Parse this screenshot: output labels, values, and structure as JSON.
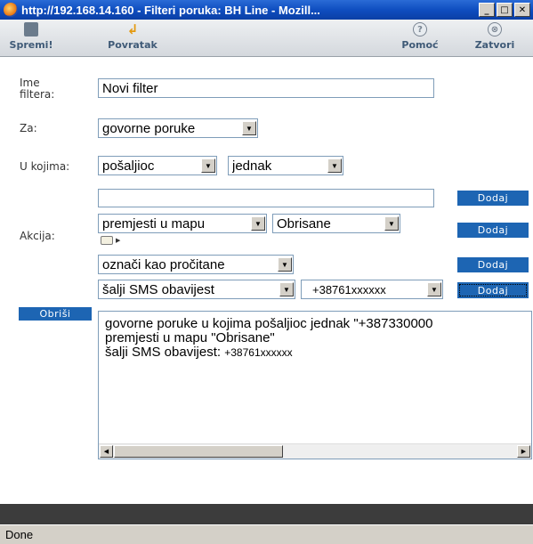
{
  "window": {
    "title": "http://192.168.14.160 - Filteri poruka: BH Line - Mozill...",
    "buttons": [
      "_",
      "□",
      "✕"
    ]
  },
  "toolbar": {
    "save_label": "Spremi!",
    "back_label": "Povratak",
    "help_label": "Pomoć",
    "close_label": "Zatvori",
    "help_glyph": "?",
    "close_glyph": "⊗",
    "back_glyph": "↲"
  },
  "form": {
    "name_label_1": "Ime",
    "name_label_2": "filtera:",
    "name_value": "Novi filter",
    "for_label": "Za:",
    "for_value": "govorne poruke",
    "where_label": "U kojima:",
    "where_field_value": "pošaljioc",
    "where_op_value": "jednak",
    "where_text_value": "",
    "add_label": "Dodaj",
    "action_label": "Akcija:",
    "action1_value": "premjesti u mapu",
    "action1_folder": "Obrisane",
    "action2_value": "označi kao pročitane",
    "action3_value": "šalji SMS obavijest",
    "action3_number": "+38761xxxxxx",
    "delete_label": "Obriši",
    "dropdown_glyph": "▼"
  },
  "summary": {
    "line1": "govorne poruke u kojima pošaljioc jednak \"+387330000",
    "line2": "premjesti u mapu \"Obrisane\"",
    "line3_text": "šalji SMS obavijest:",
    "line3_number": "+38761xxxxxx"
  },
  "scroll": {
    "left_glyph": "◀",
    "right_glyph": "▶"
  },
  "status": {
    "text": "Done"
  }
}
